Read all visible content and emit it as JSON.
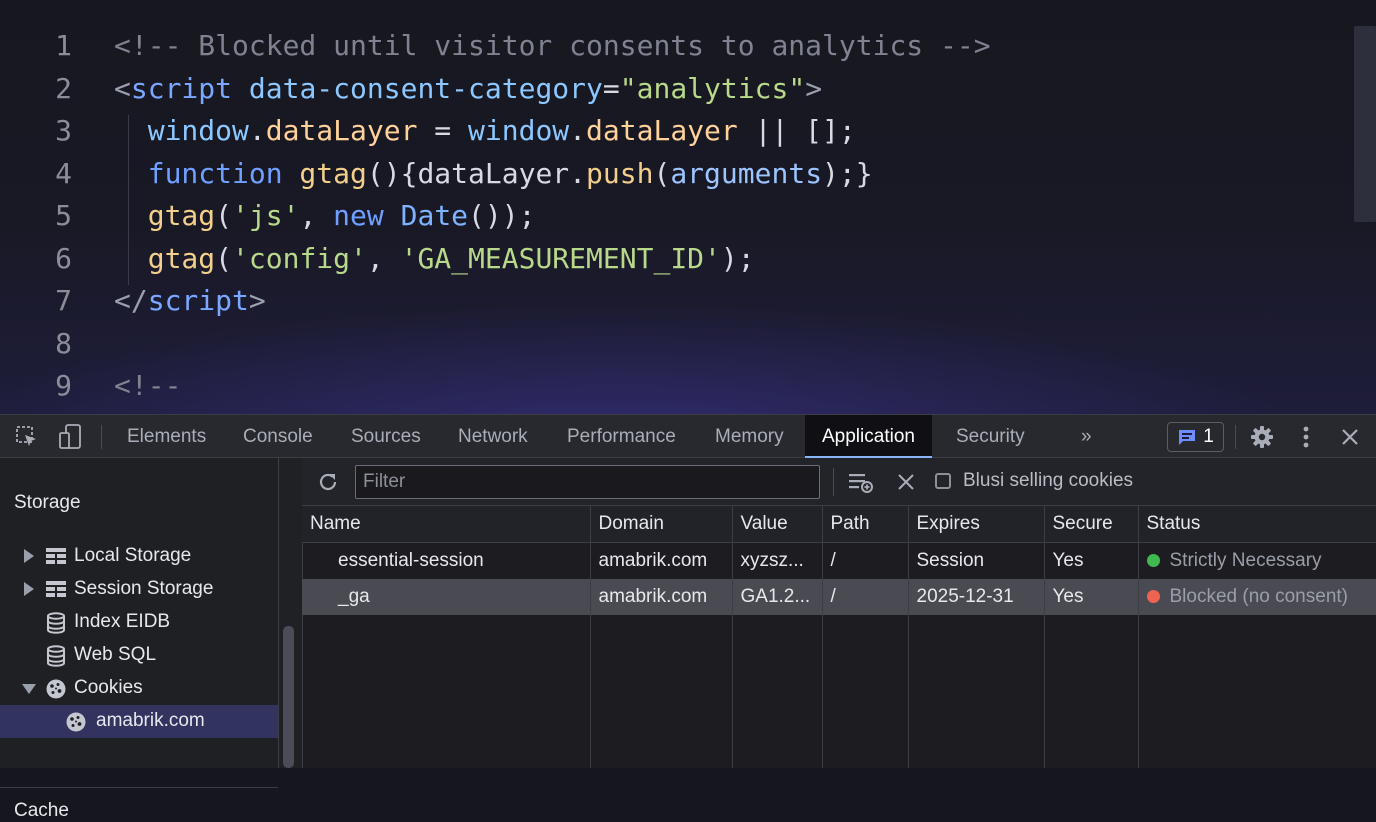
{
  "editor": {
    "lines": [
      {
        "n": "1",
        "tokens": [
          {
            "t": "<!-- Blocked until visitor consents to analytics -->",
            "c": "c-cmt"
          }
        ]
      },
      {
        "n": "2",
        "tokens": [
          {
            "t": "<",
            "c": "c-tag"
          },
          {
            "t": "script",
            "c": "c-name"
          },
          {
            "t": " data-consent-category",
            "c": "c-attr"
          },
          {
            "t": "=",
            "c": "c-op"
          },
          {
            "t": "\"analytics\"",
            "c": "c-str"
          },
          {
            "t": ">",
            "c": "c-tag"
          }
        ]
      },
      {
        "n": "3",
        "tokens": [
          {
            "t": "  window",
            "c": "c-attr"
          },
          {
            "t": ".",
            "c": "c-op"
          },
          {
            "t": "dataLayer",
            "c": "c-var"
          },
          {
            "t": " = ",
            "c": "c-op"
          },
          {
            "t": "window",
            "c": "c-attr"
          },
          {
            "t": ".",
            "c": "c-op"
          },
          {
            "t": "dataLayer",
            "c": "c-var"
          },
          {
            "t": " || [];",
            "c": "c-op"
          }
        ]
      },
      {
        "n": "4",
        "tokens": [
          {
            "t": "  function",
            "c": "c-kw"
          },
          {
            "t": " gtag",
            "c": "c-fn"
          },
          {
            "t": "(){dataLayer.",
            "c": "c-op"
          },
          {
            "t": "push",
            "c": "c-fn"
          },
          {
            "t": "(",
            "c": "c-op"
          },
          {
            "t": "arguments",
            "c": "c-param"
          },
          {
            "t": ");}",
            "c": "c-op"
          }
        ]
      },
      {
        "n": "5",
        "tokens": [
          {
            "t": "  gtag",
            "c": "c-fn"
          },
          {
            "t": "(",
            "c": "c-op"
          },
          {
            "t": "'js'",
            "c": "c-str"
          },
          {
            "t": ", ",
            "c": "c-op"
          },
          {
            "t": "new",
            "c": "c-kw"
          },
          {
            "t": " Date",
            "c": "c-cls"
          },
          {
            "t": "());",
            "c": "c-op"
          }
        ]
      },
      {
        "n": "6",
        "tokens": [
          {
            "t": "  gtag",
            "c": "c-fn"
          },
          {
            "t": "(",
            "c": "c-op"
          },
          {
            "t": "'config'",
            "c": "c-str"
          },
          {
            "t": ", ",
            "c": "c-op"
          },
          {
            "t": "'GA_MEASUREMENT_ID'",
            "c": "c-str"
          },
          {
            "t": ");",
            "c": "c-op"
          }
        ]
      },
      {
        "n": "7",
        "tokens": [
          {
            "t": "</",
            "c": "c-tag"
          },
          {
            "t": "script",
            "c": "c-name"
          },
          {
            "t": ">",
            "c": "c-tag"
          }
        ]
      },
      {
        "n": "8",
        "tokens": []
      },
      {
        "n": "9",
        "tokens": [
          {
            "t": "<!--",
            "c": "c-cmt"
          }
        ]
      }
    ]
  },
  "devtools": {
    "tabs": [
      {
        "label": "Elements",
        "name": "tab-elements"
      },
      {
        "label": "Console",
        "name": "tab-console"
      },
      {
        "label": "Sources",
        "name": "tab-sources"
      },
      {
        "label": "Network",
        "name": "tab-network"
      },
      {
        "label": "Performance",
        "name": "tab-performance"
      },
      {
        "label": "Memory",
        "name": "tab-memory"
      },
      {
        "label": "Application",
        "name": "tab-application",
        "active": true
      },
      {
        "label": "Security",
        "name": "tab-security"
      }
    ],
    "more_tabs_glyph": "»",
    "issues_count": "1",
    "icons": {
      "inspect": "inspect-element-icon",
      "device": "device-toolbar-icon",
      "more": "more-tabs-icon",
      "issues": "issues-chat-icon",
      "settings": "settings-gear-icon",
      "menu": "kebab-menu-icon",
      "close": "close-icon"
    }
  },
  "sidebar": {
    "section": "Storage",
    "items": [
      {
        "label": "Local Storage",
        "icon": "table-grid-icon",
        "arrow": "right"
      },
      {
        "label": "Session Storage",
        "icon": "table-grid-icon",
        "arrow": "right"
      },
      {
        "label": "Index EIDB",
        "icon": "database-icon",
        "arrow": ""
      },
      {
        "label": "Web SQL",
        "icon": "database-icon",
        "arrow": ""
      },
      {
        "label": "Cookies",
        "icon": "cookie-icon",
        "arrow": "down"
      },
      {
        "label": "amabrik.com",
        "icon": "cookie-icon",
        "arrow": "",
        "child": true,
        "selected": true
      }
    ],
    "next_section": "Cache"
  },
  "cookies_pane": {
    "filter_placeholder": "Filter",
    "only_blocked_label": "Blusi selling cookies",
    "columns": [
      "Name",
      "Domain",
      "Value",
      "Path",
      "Expires",
      "Secure",
      "Status"
    ],
    "rows": [
      {
        "name": "essential-session",
        "domain": "amabrik.com",
        "value": "xyzsz...",
        "path": "/",
        "expires": "Session",
        "secure": "Yes",
        "status": "Strictly Necessary",
        "status_color": "#3fb950",
        "selected": false
      },
      {
        "name": "_ga",
        "domain": "amabrik.com",
        "value": "GA1.2...",
        "path": "/",
        "expires": "2025-12-31",
        "secure": "Yes",
        "status": "Blocked (no consent)",
        "status_color": "#ef6451",
        "selected": true
      }
    ]
  },
  "colors": {
    "accent": "#8ab4f8",
    "selected_sidebar": "#32335f",
    "necessary": "#3fb950",
    "blocked": "#ef6451"
  }
}
